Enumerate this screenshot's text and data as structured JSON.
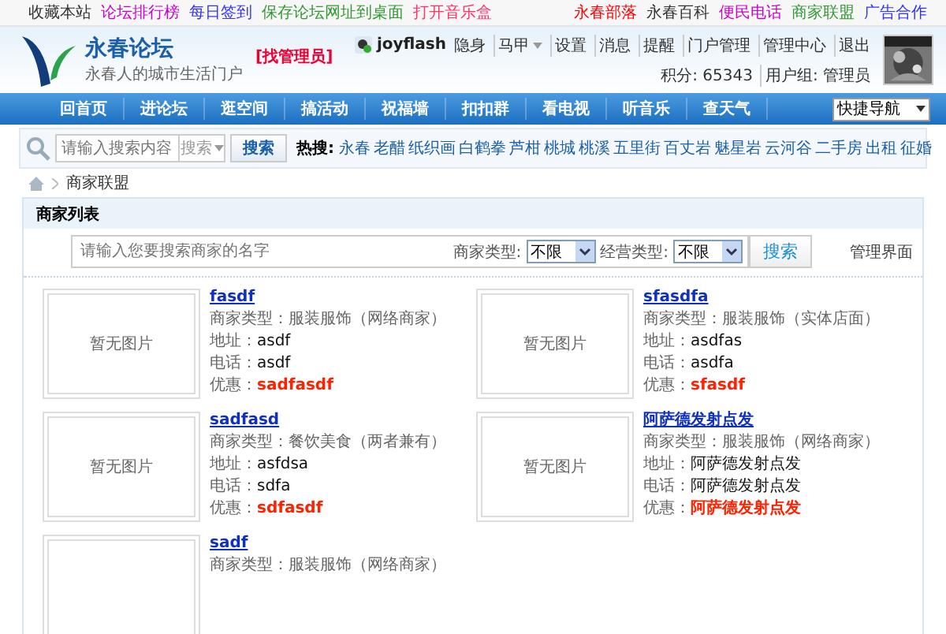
{
  "top_links": [
    {
      "text": "收藏本站",
      "color": "#333333"
    },
    {
      "text": "论坛排行榜",
      "color": "#cc00cc"
    },
    {
      "text": "每日签到",
      "color": "#3333ff"
    },
    {
      "text": "保存论坛网址到桌面",
      "color": "#339933"
    },
    {
      "text": "打开音乐盒",
      "color": "#ff3366"
    }
  ],
  "top_right_links": [
    {
      "text": "永春部落",
      "color": "#ff0000"
    },
    {
      "text": "永春百科",
      "color": "#333333"
    },
    {
      "text": "便民电话",
      "color": "#cc00cc"
    },
    {
      "text": "商家联盟",
      "color": "#339933"
    },
    {
      "text": "广告合作",
      "color": "#3333ff"
    }
  ],
  "logo": {
    "title": "永春论坛",
    "slogan": "永春人的城市生活门户"
  },
  "admin_badge": "[找管理员]",
  "user": {
    "name": "joyflash",
    "status": "隐身",
    "menu": [
      {
        "label": "马甲",
        "dropdown": true
      },
      {
        "label": "设置",
        "dropdown": false
      },
      {
        "label": "消息",
        "dropdown": false
      },
      {
        "label": "提醒",
        "dropdown": false
      },
      {
        "label": "门户管理",
        "dropdown": false
      },
      {
        "label": "管理中心",
        "dropdown": false
      },
      {
        "label": "退出",
        "dropdown": false
      }
    ],
    "points": "积分: 65343",
    "group": "用户组: 管理员"
  },
  "nav": {
    "items": [
      "回首页",
      "进论坛",
      "逛空间",
      "搞活动",
      "祝福墙",
      "扣扣群",
      "看电视",
      "听音乐",
      "查天气"
    ],
    "quick_nav": "快捷导航"
  },
  "search": {
    "placeholder": "请输入搜索内容",
    "scope": "搜索",
    "button": "搜索",
    "hot_label": "热搜:",
    "hot_words": [
      "永春",
      "老醋",
      "纸织画",
      "白鹤拳",
      "芦柑",
      "桃城",
      "桃溪",
      "五里街",
      "百丈岩",
      "魅星岩",
      "云河谷",
      "二手房",
      "出租",
      "征婚"
    ]
  },
  "breadcrumb": "商家联盟",
  "panel": {
    "title": "商家列表",
    "filter_placeholder": "请输入您要搜索商家的名字",
    "filters": [
      {
        "label": "商家类型:",
        "value": "不限"
      },
      {
        "label": "经营类型:",
        "value": "不限"
      }
    ],
    "search_button": "搜索",
    "admin_link": "管理界面",
    "merchants": [
      {
        "image_text": "暂无图片",
        "name": "fasdf",
        "fields": [
          {
            "label": "商家类型：",
            "value": "服装服饰（网络商家）",
            "kind": "plain"
          },
          {
            "label": "地址：",
            "value": "asdf",
            "kind": "strong"
          },
          {
            "label": "电话：",
            "value": "asdf",
            "kind": "strong"
          },
          {
            "label": "优惠：",
            "value": "sadfasdf",
            "kind": "offer"
          }
        ]
      },
      {
        "image_text": "暂无图片",
        "name": "sfasdfa",
        "fields": [
          {
            "label": "商家类型：",
            "value": "服装服饰（实体店面）",
            "kind": "plain"
          },
          {
            "label": "地址：",
            "value": "asdfas",
            "kind": "strong"
          },
          {
            "label": "电话：",
            "value": "asdfa",
            "kind": "strong"
          },
          {
            "label": "优惠：",
            "value": "sfasdf",
            "kind": "offer"
          }
        ]
      },
      {
        "image_text": "暂无图片",
        "name": "sadfasd",
        "fields": [
          {
            "label": "商家类型：",
            "value": "餐饮美食（两者兼有）",
            "kind": "plain"
          },
          {
            "label": "地址：",
            "value": "asfdsa",
            "kind": "strong"
          },
          {
            "label": "电话：",
            "value": "sdfa",
            "kind": "strong"
          },
          {
            "label": "优惠：",
            "value": "sdfasdf",
            "kind": "offer"
          }
        ]
      },
      {
        "image_text": "暂无图片",
        "name": "阿萨德发射点发",
        "fields": [
          {
            "label": "商家类型：",
            "value": "服装服饰（网络商家）",
            "kind": "plain"
          },
          {
            "label": "地址：",
            "value": "阿萨德发射点发",
            "kind": "strong"
          },
          {
            "label": "电话：",
            "value": "阿萨德发射点发",
            "kind": "strong"
          },
          {
            "label": "优惠：",
            "value": "阿萨德发射点发",
            "kind": "offer"
          }
        ]
      },
      {
        "name": "sadf",
        "fields": [
          {
            "label": "商家类型：",
            "value": "服装服饰（网络商家）",
            "kind": "plain"
          }
        ]
      }
    ]
  }
}
